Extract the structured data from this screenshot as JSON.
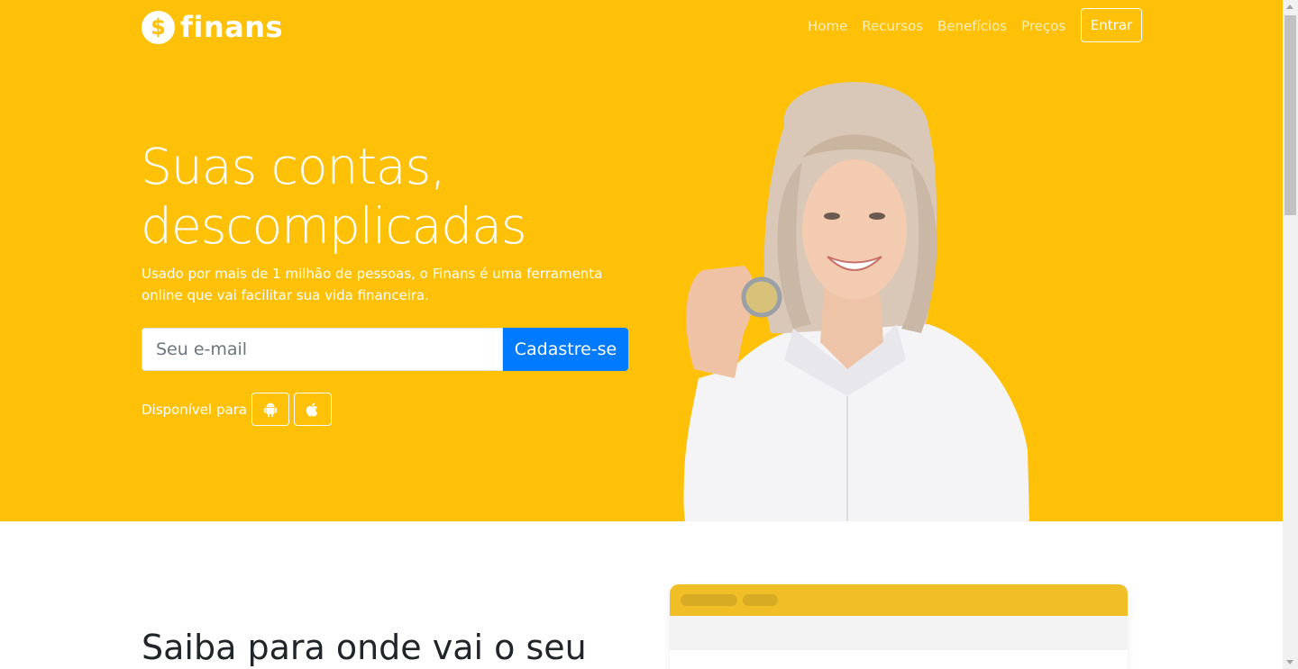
{
  "brand": {
    "icon": "dollar-icon",
    "icon_glyph": "$",
    "name": "finans"
  },
  "nav": {
    "items": [
      "Home",
      "Recursos",
      "Benefícios",
      "Preços"
    ],
    "login_label": "Entrar"
  },
  "hero": {
    "headline_line1": "Suas contas,",
    "headline_line2": "descomplicadas",
    "lead": "Usado por mais de 1 milhão de pessoas, o Finans é uma ferramenta online que vai facilitar sua vida financeira.",
    "email_placeholder": "Seu e-mail",
    "signup_label": "Cadastre-se",
    "available_label": "Disponível para",
    "stores": [
      "android-icon",
      "apple-icon"
    ],
    "image": "woman-holding-coin-photo"
  },
  "section": {
    "title": "Saiba para onde vai o seu"
  },
  "colors": {
    "hero_bg": "#ffc107",
    "primary_button": "#007bff",
    "mockup_bar": "#f0bf28"
  }
}
